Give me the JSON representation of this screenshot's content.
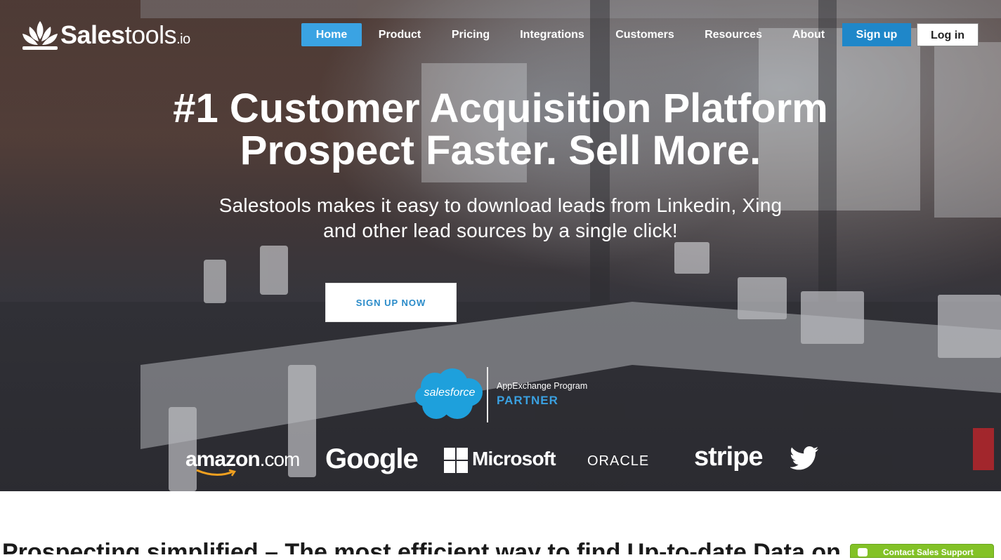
{
  "brand": {
    "name_bold": "Sales",
    "name_light": "tools",
    "tld": ".io"
  },
  "nav": {
    "items": [
      "Home",
      "Product",
      "Pricing",
      "Integrations",
      "Customers",
      "Resources",
      "About"
    ],
    "active": "Home",
    "signup": "Sign up",
    "login": "Log in"
  },
  "hero": {
    "headline_1": "#1 Customer Acquisition Platform",
    "headline_2": "Prospect Faster. Sell More.",
    "subtitle_1": "Salestools makes it easy to download leads from Linkedin, Xing",
    "subtitle_2": "and other lead sources by a single click!",
    "cta": "SIGN UP NOW"
  },
  "salesforce_badge": {
    "cloud_label": "salesforce",
    "program": "AppExchange Program",
    "partner": "PARTNER"
  },
  "partners": {
    "amazon": "amazon",
    "amazon_domain": ".com",
    "google": "Google",
    "microsoft": "Microsoft",
    "oracle": "ORACLE",
    "stripe": "stripe",
    "twitter_icon": "twitter-bird-icon"
  },
  "section": {
    "title": "Prospecting simplified – The most efficient way to find Up-to-date Data on"
  },
  "chat": {
    "label": "Contact Sales Support",
    "icon": "chat-bubble-icon"
  },
  "colors": {
    "nav_active": "#3aa3e3",
    "signup": "#1f87c9",
    "cta_text": "#2a8bc9",
    "partner_blue": "#3aa0e0",
    "salesforce_cloud": "#1ea0dc",
    "chat_green": "#83c227"
  }
}
